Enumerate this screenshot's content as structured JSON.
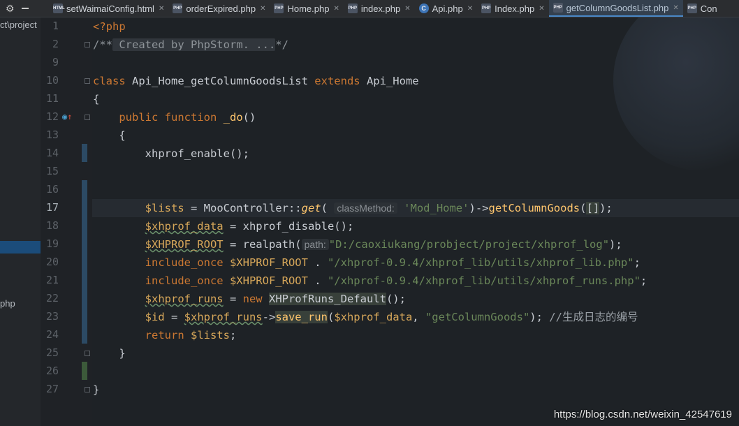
{
  "tabs": [
    {
      "label": "setWaimaiConfig.html",
      "icon": "html-file-icon",
      "active": false
    },
    {
      "label": "orderExpired.php",
      "icon": "php-file-icon",
      "active": false
    },
    {
      "label": "Home.php",
      "icon": "php-file-icon",
      "active": false
    },
    {
      "label": "index.php",
      "icon": "php-file-icon",
      "active": false
    },
    {
      "label": "Api.php",
      "icon": "php-class-icon",
      "active": false
    },
    {
      "label": "Index.php",
      "icon": "php-file-icon",
      "active": false
    },
    {
      "label": "getColumnGoodsList.php",
      "icon": "php-file-icon",
      "active": true
    },
    {
      "label": "Con",
      "icon": "php-file-icon",
      "active": false
    }
  ],
  "sidebar": {
    "path_text": "ct\\project",
    "file_text": "php"
  },
  "gutter": {
    "line_numbers": [
      "1",
      "2",
      "9",
      "10",
      "11",
      "12",
      "13",
      "14",
      "15",
      "16",
      "17",
      "18",
      "19",
      "20",
      "21",
      "22",
      "23",
      "24",
      "25",
      "26",
      "27"
    ],
    "current_line": "17"
  },
  "code": {
    "l1_open": "<?php",
    "l2_doc_open": "/**",
    "l2_folded": " Created by PhpStorm. ...",
    "l2_doc_close": "*/",
    "l10_class": "class",
    "l10_name": " Api_Home_getColumnGoodsList ",
    "l10_extends": "extends",
    "l10_parent": " Api_Home",
    "l11_brace": "{",
    "l12_indent": "    ",
    "l12_public": "public",
    "l12_function": " function ",
    "l12_name": "_do",
    "l12_parens": "()",
    "l13_brace": "    {",
    "l14_indent": "        ",
    "l14_call": "xhprof_enable();",
    "l17_indent": "        ",
    "l17_var": "$lists",
    "l17_assign": " = MooController::",
    "l17_get": "get",
    "l17_paren": "(",
    "l17_hint": "classMethod:",
    "l17_str": "'Mod_Home'",
    "l17_arrow": ")->",
    "l17_method": "getColumnGoods",
    "l17_open": "(",
    "l17_arr": "[]",
    "l17_end": ");",
    "l18_indent": "        ",
    "l18_var": "$xhprof_data",
    "l18_rest": " = xhprof_disable();",
    "l19_indent": "        ",
    "l19_var": "$XHPROF_ROOT",
    "l19_rest": " = realpath(",
    "l19_hint": "path:",
    "l19_str": "\"D:/caoxiukang/probject/project/xhprof_log\"",
    "l19_end": ");",
    "l20_indent": "        ",
    "l20_kw": "include_once",
    "l20_var": " $XHPROF_ROOT",
    "l20_dot": " . ",
    "l20_str": "\"/xhprof-0.9.4/xhprof_lib/utils/xhprof_lib.php\"",
    "l20_end": ";",
    "l21_indent": "        ",
    "l21_kw": "include_once",
    "l21_var": " $XHPROF_ROOT",
    "l21_dot": " . ",
    "l21_str": "\"/xhprof-0.9.4/xhprof_lib/utils/xhprof_runs.php\"",
    "l21_end": ";",
    "l22_indent": "        ",
    "l22_var": "$xhprof_runs",
    "l22_eq": " = ",
    "l22_new": "new",
    "l22_sp": " ",
    "l22_class": "XHProfRuns_Default",
    "l22_end": "();",
    "l23_indent": "        ",
    "l23_var": "$id",
    "l23_eq": " = ",
    "l23_var2": "$xhprof_runs",
    "l23_arrow": "->",
    "l23_method": "save_run",
    "l23_open": "(",
    "l23_var3": "$xhprof_data",
    "l23_comma": ", ",
    "l23_str": "\"getColumnGoods\"",
    "l23_end": "); ",
    "l23_comment": "//生成日志的编号",
    "l24_indent": "        ",
    "l24_kw": "return",
    "l24_var": " $lists",
    "l24_end": ";",
    "l25_brace": "    }",
    "l27_brace": "}"
  },
  "watermark": "https://blog.csdn.net/weixin_42547619"
}
